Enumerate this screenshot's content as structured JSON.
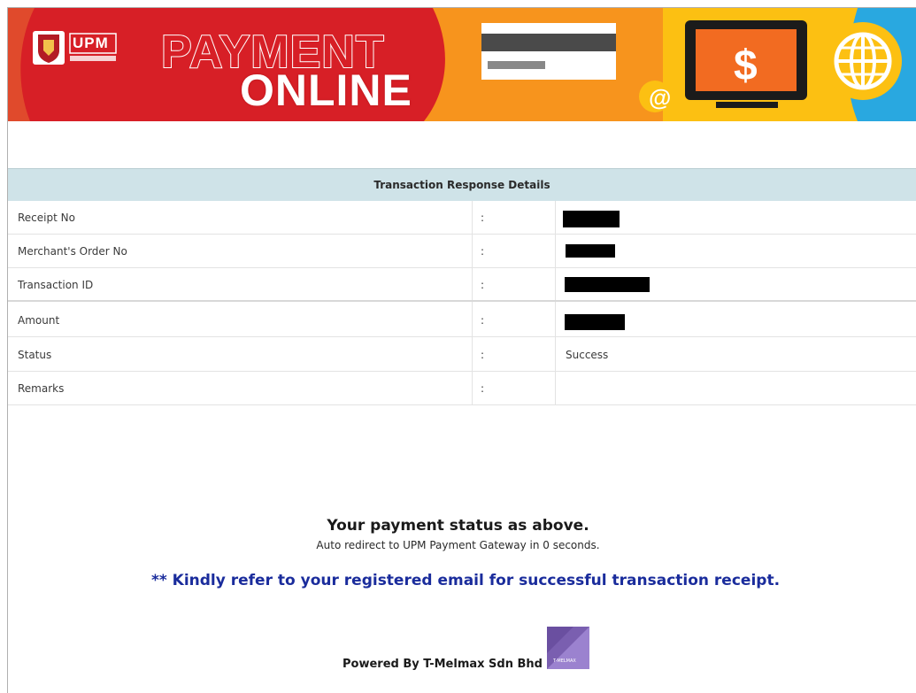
{
  "banner": {
    "title_line1": "PAYMENT",
    "title_line2": "ONLINE",
    "logo_text": "UPM",
    "dollar": "$",
    "at": "@",
    "colors": {
      "red": "#d71f26",
      "orange": "#f7941d",
      "yellow": "#fcc012",
      "blue": "#29a8e0"
    }
  },
  "table": {
    "header": "Transaction Response Details",
    "rows": [
      {
        "label": "Receipt No",
        "sep": ":",
        "value": ""
      },
      {
        "label": "Merchant's Order No",
        "sep": ":",
        "value": ""
      },
      {
        "label": "Transaction ID",
        "sep": ":",
        "value": ""
      },
      {
        "label": "Amount",
        "sep": ":",
        "value": ""
      },
      {
        "label": "Status",
        "sep": ":",
        "value": "Success"
      },
      {
        "label": "Remarks",
        "sep": ":",
        "value": ""
      }
    ]
  },
  "status": {
    "main": "Your payment status as above.",
    "sub": "Auto redirect to UPM Payment Gateway in 0 seconds."
  },
  "notice": "** Kindly refer to your registered email for successful transaction receipt.",
  "footer": {
    "powered": "Powered By T-Melmax Sdn Bhd",
    "logo_text": "T-MELMAX"
  }
}
